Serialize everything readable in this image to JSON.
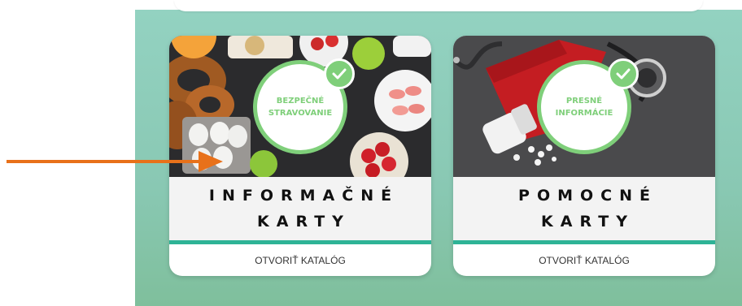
{
  "colors": {
    "panel_top": "#93d2c1",
    "panel_bottom": "#7fbf9c",
    "badge_green": "#7fcf7a",
    "accent_teal": "#2eb396",
    "arrow_orange": "#e8711a"
  },
  "cards": [
    {
      "badge": "BEZPEČNÉ\nSTRAVOVANIE",
      "title": "INFORMAČNÉ\nKARTY",
      "cta": "OTVORIŤ KATALÓG",
      "photo": "food-photo",
      "check_icon": "check-icon"
    },
    {
      "badge": "PRESNÉ\nINFORMÁCIE",
      "title": "POMOCNÉ\nKARTY",
      "cta": "OTVORIŤ KATALÓG",
      "photo": "medical-photo",
      "check_icon": "check-icon"
    }
  ],
  "annotation": {
    "arrow_icon": "arrow-right-icon"
  }
}
